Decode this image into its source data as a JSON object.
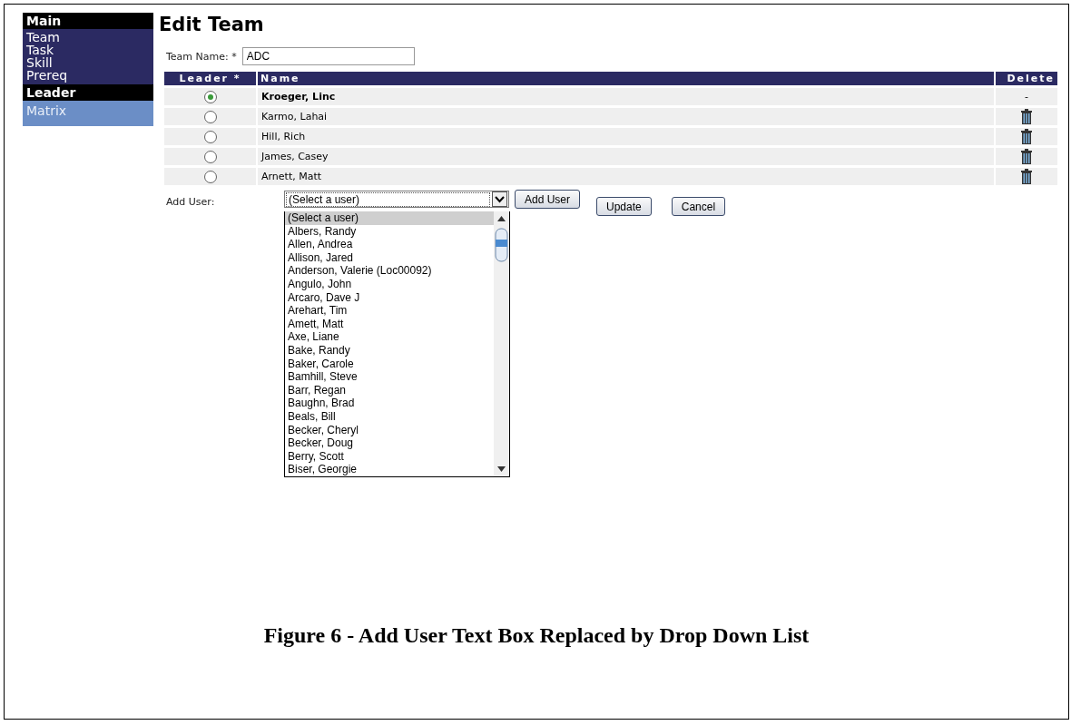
{
  "sidebar": {
    "sections": [
      {
        "title": "Main",
        "kind": "dark",
        "items": [
          "Team",
          "Task",
          "Skill",
          "Prereq"
        ]
      },
      {
        "title": "Leader",
        "kind": "light",
        "items": [
          "Matrix"
        ]
      }
    ]
  },
  "title": "Edit Team",
  "team_name": {
    "label": "Team Name: *",
    "value": "ADC"
  },
  "table": {
    "columns": [
      "Leader *",
      "Name",
      "Delete"
    ],
    "rows": [
      {
        "selected": true,
        "name": "Kroeger, Linc",
        "delete": {
          "kind": "text",
          "text": "-"
        }
      },
      {
        "selected": false,
        "name": "Karmo, Lahai",
        "delete": {
          "kind": "icon"
        }
      },
      {
        "selected": false,
        "name": "Hill, Rich",
        "delete": {
          "kind": "icon"
        }
      },
      {
        "selected": false,
        "name": "James, Casey",
        "delete": {
          "kind": "icon"
        }
      },
      {
        "selected": false,
        "name": "Arnett, Matt",
        "delete": {
          "kind": "icon"
        }
      }
    ]
  },
  "add_user": {
    "label": "Add User:",
    "value": "(Select a user)",
    "button": "Add User",
    "options": [
      {
        "label": "(Select a user)",
        "selected": true
      },
      {
        "label": "Albers, Randy",
        "selected": false
      },
      {
        "label": "Allen, Andrea",
        "selected": false
      },
      {
        "label": "Allison, Jared",
        "selected": false
      },
      {
        "label": "Anderson, Valerie (Loc00092)",
        "selected": false
      },
      {
        "label": "Angulo, John",
        "selected": false
      },
      {
        "label": "Arcaro, Dave J",
        "selected": false
      },
      {
        "label": "Arehart, Tim",
        "selected": false
      },
      {
        "label": "Amett, Matt",
        "selected": false
      },
      {
        "label": "Axe, Liane",
        "selected": false
      },
      {
        "label": "Bake, Randy",
        "selected": false
      },
      {
        "label": "Baker, Carole",
        "selected": false
      },
      {
        "label": "Bamhill, Steve",
        "selected": false
      },
      {
        "label": "Barr, Regan",
        "selected": false
      },
      {
        "label": "Baughn, Brad",
        "selected": false
      },
      {
        "label": "Beals, Bill",
        "selected": false
      },
      {
        "label": "Becker, Cheryl",
        "selected": false
      },
      {
        "label": "Becker, Doug",
        "selected": false
      },
      {
        "label": "Berry, Scott",
        "selected": false
      },
      {
        "label": "Biser, Georgie",
        "selected": false
      }
    ]
  },
  "buttons": [
    "Update",
    "Cancel"
  ],
  "caption": "Figure 6 - Add User Text Box Replaced by Drop Down List"
}
